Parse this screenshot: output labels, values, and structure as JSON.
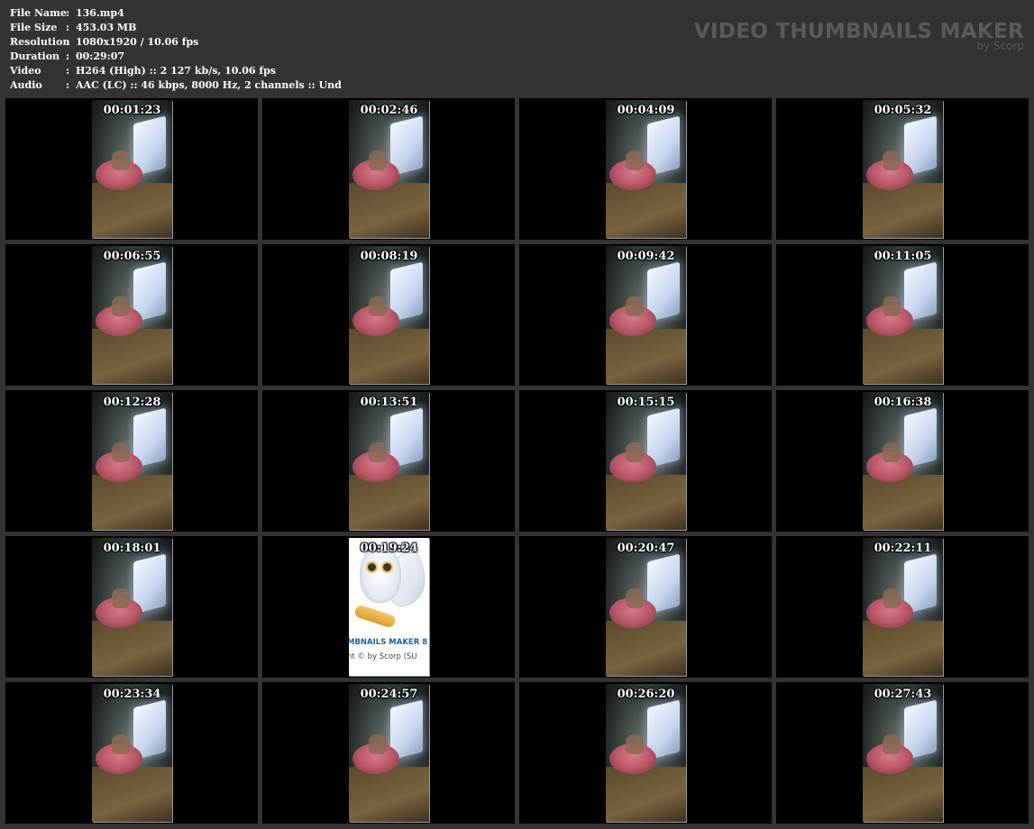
{
  "info": [
    {
      "key": "File Name",
      "sep": ":",
      "value": "136.mp4"
    },
    {
      "key": "File Size",
      "sep": ":",
      "value": "453.03 MB"
    },
    {
      "key": "Resolution",
      "sep": ":",
      "value": "1080x1920 / 10.06 fps"
    },
    {
      "key": "Duration",
      "sep": ":",
      "value": "00:29:07"
    },
    {
      "key": "Video",
      "sep": ":",
      "value": "H264 (High) :: 2 127 kb/s, 10.06 fps"
    },
    {
      "key": "Audio",
      "sep": ":",
      "value": "AAC (LC) :: 46 kbps, 8000 Hz, 2 channels :: Und"
    }
  ],
  "brand": {
    "title": "VIDEO THUMBNAILS MAKER",
    "subtitle": "by Scorp"
  },
  "owl_frame": {
    "line1": "MBNAILS MAKER 8",
    "line2": "nt © by Scorp (SU"
  },
  "thumbnails": [
    {
      "time": "00:01:23",
      "kind": "video"
    },
    {
      "time": "00:02:46",
      "kind": "video"
    },
    {
      "time": "00:04:09",
      "kind": "video"
    },
    {
      "time": "00:05:32",
      "kind": "video"
    },
    {
      "time": "00:06:55",
      "kind": "video"
    },
    {
      "time": "00:08:19",
      "kind": "video"
    },
    {
      "time": "00:09:42",
      "kind": "video"
    },
    {
      "time": "00:11:05",
      "kind": "video"
    },
    {
      "time": "00:12:28",
      "kind": "video"
    },
    {
      "time": "00:13:51",
      "kind": "video"
    },
    {
      "time": "00:15:15",
      "kind": "video"
    },
    {
      "time": "00:16:38",
      "kind": "video"
    },
    {
      "time": "00:18:01",
      "kind": "video"
    },
    {
      "time": "00:19:24",
      "kind": "owl"
    },
    {
      "time": "00:20:47",
      "kind": "video"
    },
    {
      "time": "00:22:11",
      "kind": "video"
    },
    {
      "time": "00:23:34",
      "kind": "video"
    },
    {
      "time": "00:24:57",
      "kind": "video"
    },
    {
      "time": "00:26:20",
      "kind": "video"
    },
    {
      "time": "00:27:43",
      "kind": "video"
    }
  ],
  "colors": {
    "background": "#333333",
    "cell": "#000000",
    "brand_text": "#5a5a5a",
    "info_text": "#ffffff"
  }
}
